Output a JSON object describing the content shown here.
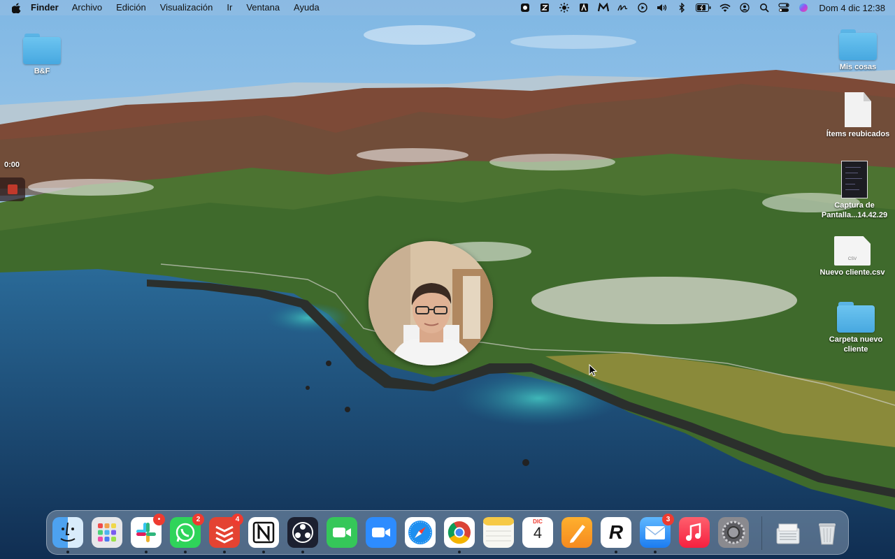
{
  "menubar": {
    "app_name": "Finder",
    "menus": [
      "Archivo",
      "Edición",
      "Visualización",
      "Ir",
      "Ventana",
      "Ayuda"
    ],
    "status_icons": [
      "screen-recorder-icon",
      "app-icon",
      "sun-icon",
      "app-a-icon",
      "m-app-icon",
      "signature-icon",
      "play-circle-icon",
      "volume-icon",
      "bluetooth-icon",
      "battery-icon",
      "wifi-icon",
      "user-icon",
      "search-icon",
      "control-center-icon",
      "siri-icon"
    ],
    "clock": "Dom 4 dic 12:38"
  },
  "desktop": {
    "items": [
      {
        "label": "B&F",
        "kind": "folder"
      },
      {
        "label": "Mis cosas",
        "kind": "folder"
      },
      {
        "label": "Ítems reubicados",
        "kind": "document"
      },
      {
        "label": "Captura de Pantalla...14.42.29",
        "kind": "screenshot"
      },
      {
        "label": "Nuevo cliente.csv",
        "kind": "csv",
        "file_tag": "CSV"
      },
      {
        "label": "Carpeta nuevo cliente",
        "kind": "folder"
      }
    ]
  },
  "recorder": {
    "elapsed": "0:00"
  },
  "dock": {
    "apps": [
      {
        "name": "Finder",
        "icon": "finder-icon",
        "running": true
      },
      {
        "name": "Launchpad",
        "icon": "launchpad-icon",
        "running": false
      },
      {
        "name": "Slack",
        "icon": "slack-icon",
        "running": true,
        "badge": "•"
      },
      {
        "name": "WhatsApp",
        "icon": "whatsapp-icon",
        "running": true,
        "badge": "2"
      },
      {
        "name": "Todoist",
        "icon": "todoist-icon",
        "running": true,
        "badge": "4"
      },
      {
        "name": "Notion",
        "icon": "notion-icon",
        "running": true
      },
      {
        "name": "OBS",
        "icon": "obs-icon",
        "running": true
      },
      {
        "name": "FaceTime",
        "icon": "facetime-icon",
        "running": false
      },
      {
        "name": "Zoom",
        "icon": "zoom-icon",
        "running": false
      },
      {
        "name": "Safari",
        "icon": "safari-icon",
        "running": false
      },
      {
        "name": "Chrome",
        "icon": "chrome-icon",
        "running": true
      },
      {
        "name": "Notas",
        "icon": "notes-icon",
        "running": false
      },
      {
        "name": "Calendario",
        "icon": "calendar-icon",
        "running": false,
        "month": "DIC",
        "day": "4"
      },
      {
        "name": "Pages",
        "icon": "pages-icon",
        "running": false
      },
      {
        "name": "Reeder",
        "icon": "reeder-icon",
        "running": true,
        "glyph": "R"
      },
      {
        "name": "Mail",
        "icon": "mail-icon",
        "running": true,
        "badge": "3"
      },
      {
        "name": "Música",
        "icon": "music-icon",
        "running": false
      },
      {
        "name": "Preferencias del Sistema",
        "icon": "system-preferences-icon",
        "running": false
      },
      {
        "name": "Carpeta de descargas",
        "icon": "downloads-stack-icon",
        "running": false
      },
      {
        "name": "Papelera",
        "icon": "trash-icon",
        "running": false
      }
    ]
  },
  "colors": {
    "sky": "#8fc3ea",
    "sea": "#1d4f7e",
    "hills_green": "#4f7a36",
    "hills_red": "#8a4b35",
    "folder_blue": "#5ab4e6",
    "badge_red": "#ee3b30"
  }
}
